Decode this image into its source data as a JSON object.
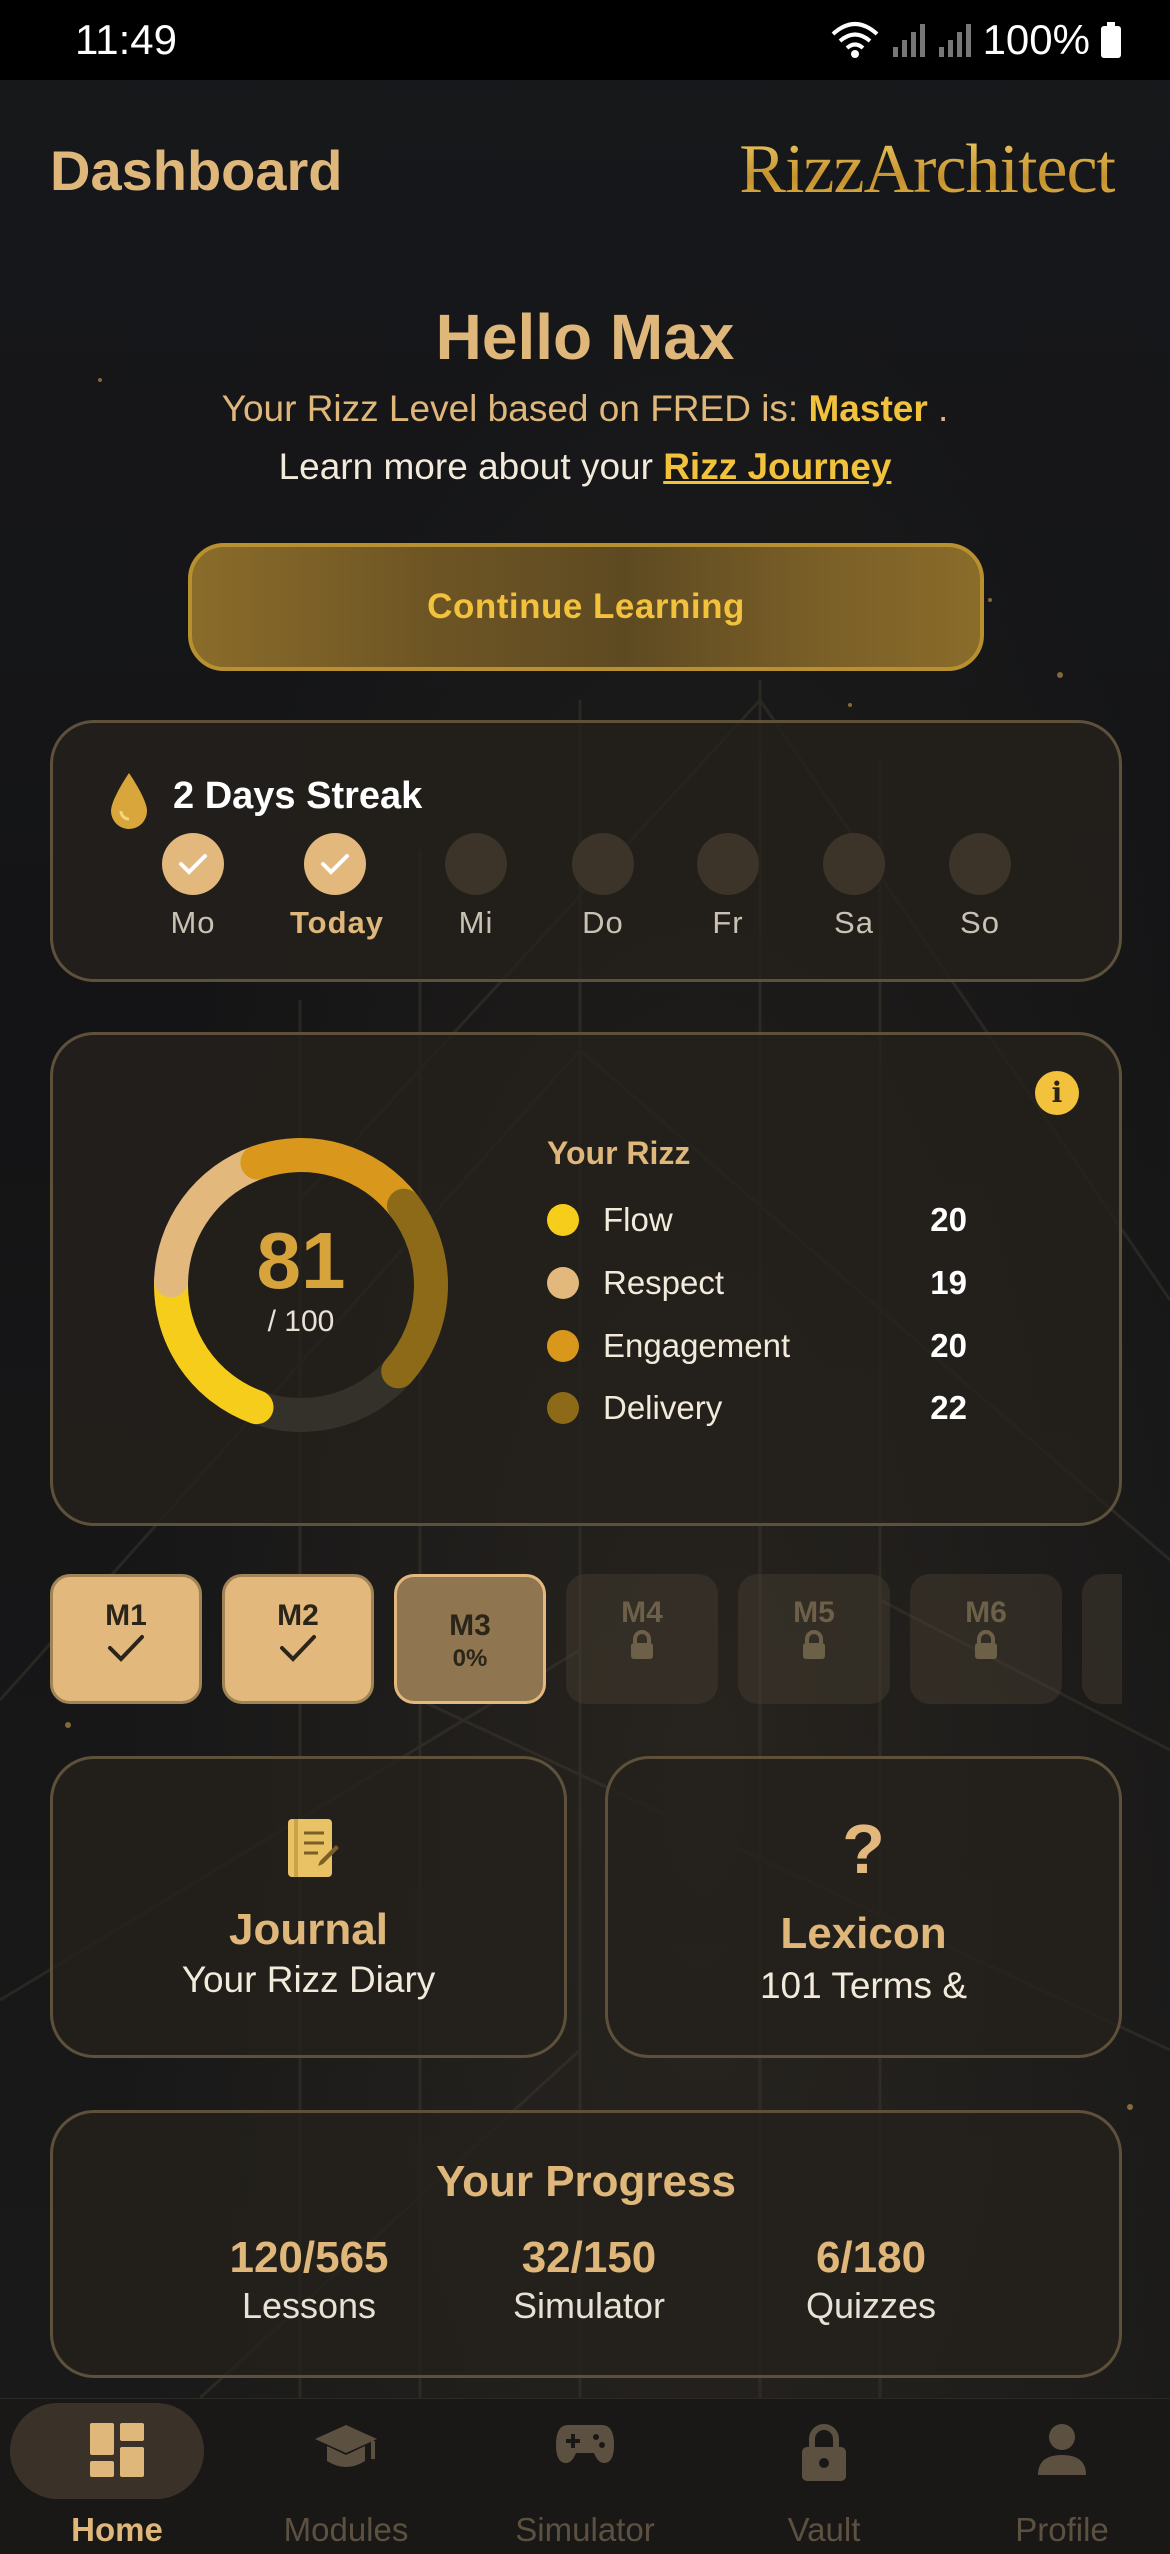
{
  "status_bar": {
    "time": "11:49",
    "battery": "100%"
  },
  "header": {
    "title": "Dashboard",
    "brand": "RizzArchitect"
  },
  "hero": {
    "greeting": "Hello Max",
    "level_prefix": "Your Rizz Level based on FRED is:",
    "level_value": "Master",
    "level_suffix": ".",
    "journey_prefix": "Learn more about your",
    "journey_link": "Rizz Journey",
    "continue_label": "Continue Learning"
  },
  "streak": {
    "title": "2 Days Streak",
    "days": [
      {
        "label": "Mo",
        "done": true
      },
      {
        "label": "Today",
        "done": true
      },
      {
        "label": "Mi",
        "done": false
      },
      {
        "label": "Do",
        "done": false
      },
      {
        "label": "Fr",
        "done": false
      },
      {
        "label": "Sa",
        "done": false
      },
      {
        "label": "So",
        "done": false
      }
    ]
  },
  "rizz": {
    "title": "Your Rizz",
    "score": "81",
    "max": "/ 100",
    "metrics": [
      {
        "name": "Flow",
        "value": "20",
        "color": "#f6cd1a"
      },
      {
        "name": "Respect",
        "value": "19",
        "color": "#e2b87d"
      },
      {
        "name": "Engagement",
        "value": "20",
        "color": "#d9981c"
      },
      {
        "name": "Delivery",
        "value": "22",
        "color": "#8c6a17"
      }
    ]
  },
  "modules": [
    {
      "name": "M1",
      "state": "done"
    },
    {
      "name": "M2",
      "state": "done"
    },
    {
      "name": "M3",
      "state": "current",
      "progress": "0%"
    },
    {
      "name": "M4",
      "state": "locked"
    },
    {
      "name": "M5",
      "state": "locked"
    },
    {
      "name": "M6",
      "state": "locked"
    }
  ],
  "tiles": {
    "journal": {
      "title": "Journal",
      "subtitle": "Your Rizz Diary"
    },
    "lexicon": {
      "title": "Lexicon",
      "subtitle": "101 Terms &"
    }
  },
  "progress": {
    "title": "Your Progress",
    "lessons": {
      "value": "120/565",
      "label": "Lessons"
    },
    "simulator": {
      "value": "32/150",
      "label": "Simulator"
    },
    "quizzes": {
      "value": "6/180",
      "label": "Quizzes"
    }
  },
  "nav": {
    "home": "Home",
    "modules": "Modules",
    "simulator": "Simulator",
    "vault": "Vault",
    "profile": "Profile"
  },
  "colors": {
    "accent": "#e0b77a",
    "gold": "#f2c23c",
    "card_border": "#5e513b"
  }
}
